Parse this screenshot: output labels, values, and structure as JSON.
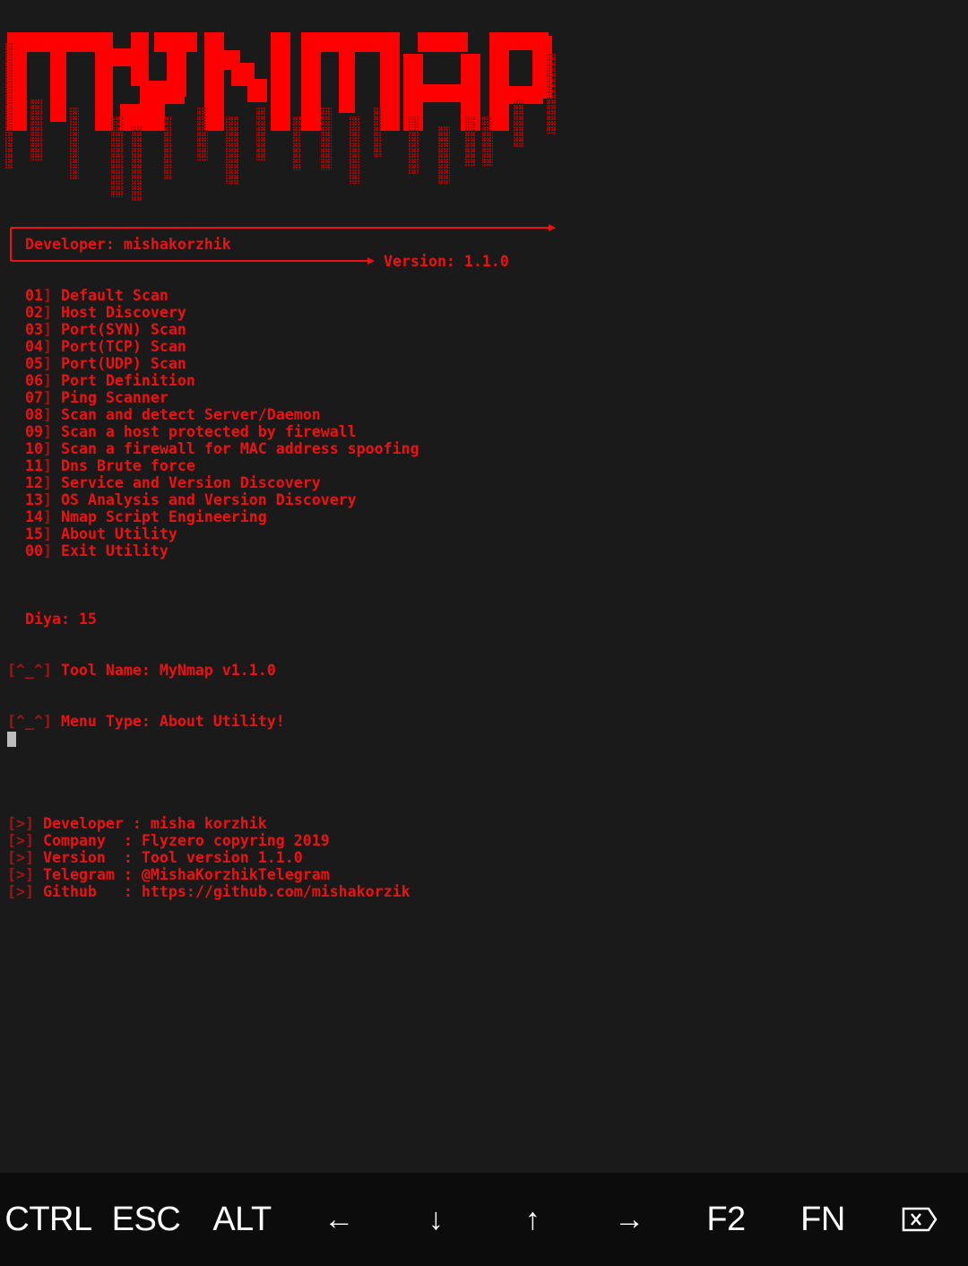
{
  "colors": {
    "background": "#1a1a1a",
    "text_red": "#ee1111",
    "bracket_red": "#a31414",
    "keybar_bg": "#0c0c0c",
    "key_text": "#ffffff",
    "cursor": "#bdbdbd"
  },
  "logo": {
    "text": "MYNMAP",
    "style": "dripping red ascii block letters"
  },
  "banner": {
    "developer": "Developer: mishakorzhik",
    "version": "Version: 1.1.0"
  },
  "menu": [
    {
      "num": "01",
      "label": "Default Scan"
    },
    {
      "num": "02",
      "label": "Host Discovery"
    },
    {
      "num": "03",
      "label": "Port(SYN) Scan"
    },
    {
      "num": "04",
      "label": "Port(TCP) Scan"
    },
    {
      "num": "05",
      "label": "Port(UDP) Scan"
    },
    {
      "num": "06",
      "label": "Port Definition"
    },
    {
      "num": "07",
      "label": "Ping Scanner"
    },
    {
      "num": "08",
      "label": "Scan and detect Server/Daemon"
    },
    {
      "num": "09",
      "label": "Scan a host protected by firewall"
    },
    {
      "num": "10",
      "label": "Scan a firewall for MAC address spoofing"
    },
    {
      "num": "11",
      "label": "Dns Brute force"
    },
    {
      "num": "12",
      "label": "Service and Version Discovery"
    },
    {
      "num": "13",
      "label": "OS Analysis and Version Discovery"
    },
    {
      "num": "14",
      "label": "Nmap Script Engineering"
    },
    {
      "num": "15",
      "label": "About Utility"
    },
    {
      "num": "00",
      "label": "Exit Utility"
    }
  ],
  "prompt": {
    "text": "Diya: 15"
  },
  "tool_info": {
    "prefix": "[^_^]",
    "tool_name": "Tool Name: MyNmap v1.1.0",
    "menu_type": "Menu Type: About Utility!"
  },
  "about": {
    "prefix": "[>]",
    "rows": [
      {
        "key": "Developer",
        "value": "misha korzhik"
      },
      {
        "key": "Company",
        "value": "Flyzero copyring 2019"
      },
      {
        "key": "Version",
        "value": "Tool version 1.1.0"
      },
      {
        "key": "Telegram",
        "value": "@MishaKorzhikTelegram"
      },
      {
        "key": "Github",
        "value": "https://github.com/mishakorzik"
      }
    ]
  },
  "extra_keys": [
    {
      "label": "CTRL",
      "icon": ""
    },
    {
      "label": "ESC",
      "icon": ""
    },
    {
      "label": "ALT",
      "icon": ""
    },
    {
      "label": "←",
      "icon": "arrow-left-icon"
    },
    {
      "label": "↓",
      "icon": "arrow-down-icon"
    },
    {
      "label": "↑",
      "icon": "arrow-up-icon"
    },
    {
      "label": "→",
      "icon": "arrow-right-icon"
    },
    {
      "label": "F2",
      "icon": ""
    },
    {
      "label": "FN",
      "icon": ""
    },
    {
      "label": "",
      "icon": "backspace-icon"
    }
  ]
}
